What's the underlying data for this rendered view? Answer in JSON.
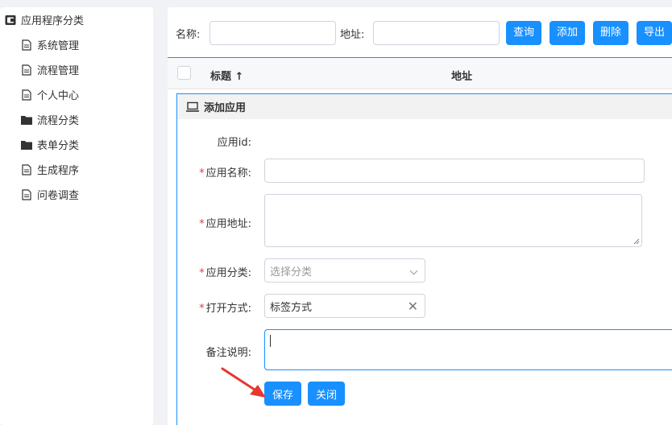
{
  "sidebar": {
    "root_label": "应用程序分类",
    "items": [
      {
        "label": "系统管理",
        "icon": "document-icon"
      },
      {
        "label": "流程管理",
        "icon": "document-icon"
      },
      {
        "label": "个人中心",
        "icon": "document-icon"
      },
      {
        "label": "流程分类",
        "icon": "folder-icon"
      },
      {
        "label": "表单分类",
        "icon": "folder-icon"
      },
      {
        "label": "生成程序",
        "icon": "document-icon"
      },
      {
        "label": "问卷调查",
        "icon": "document-icon"
      }
    ]
  },
  "search": {
    "name_label": "名称:",
    "name_value": "",
    "address_label": "地址:",
    "address_value": ""
  },
  "toolbar": {
    "query": "查询",
    "add": "添加",
    "delete": "删除",
    "export": "导出"
  },
  "grid": {
    "col_title": "标题 ↑",
    "col_address": "地址"
  },
  "dialog": {
    "title": "添加应用",
    "app_id_label": "应用id:",
    "app_id_value": "",
    "app_name_label": "应用名称:",
    "app_name_value": "",
    "app_address_label": "应用地址:",
    "app_address_value": "",
    "app_category_label": "应用分类:",
    "app_category_placeholder": "选择分类",
    "open_mode_label": "打开方式:",
    "open_mode_value": "标签方式",
    "remark_label": "备注说明:",
    "remark_value": "",
    "save": "保存",
    "close": "关闭",
    "required_mark": "*"
  },
  "colors": {
    "accent": "#1890ff",
    "required": "#e4393c",
    "annotation_arrow": "#e8372e"
  }
}
